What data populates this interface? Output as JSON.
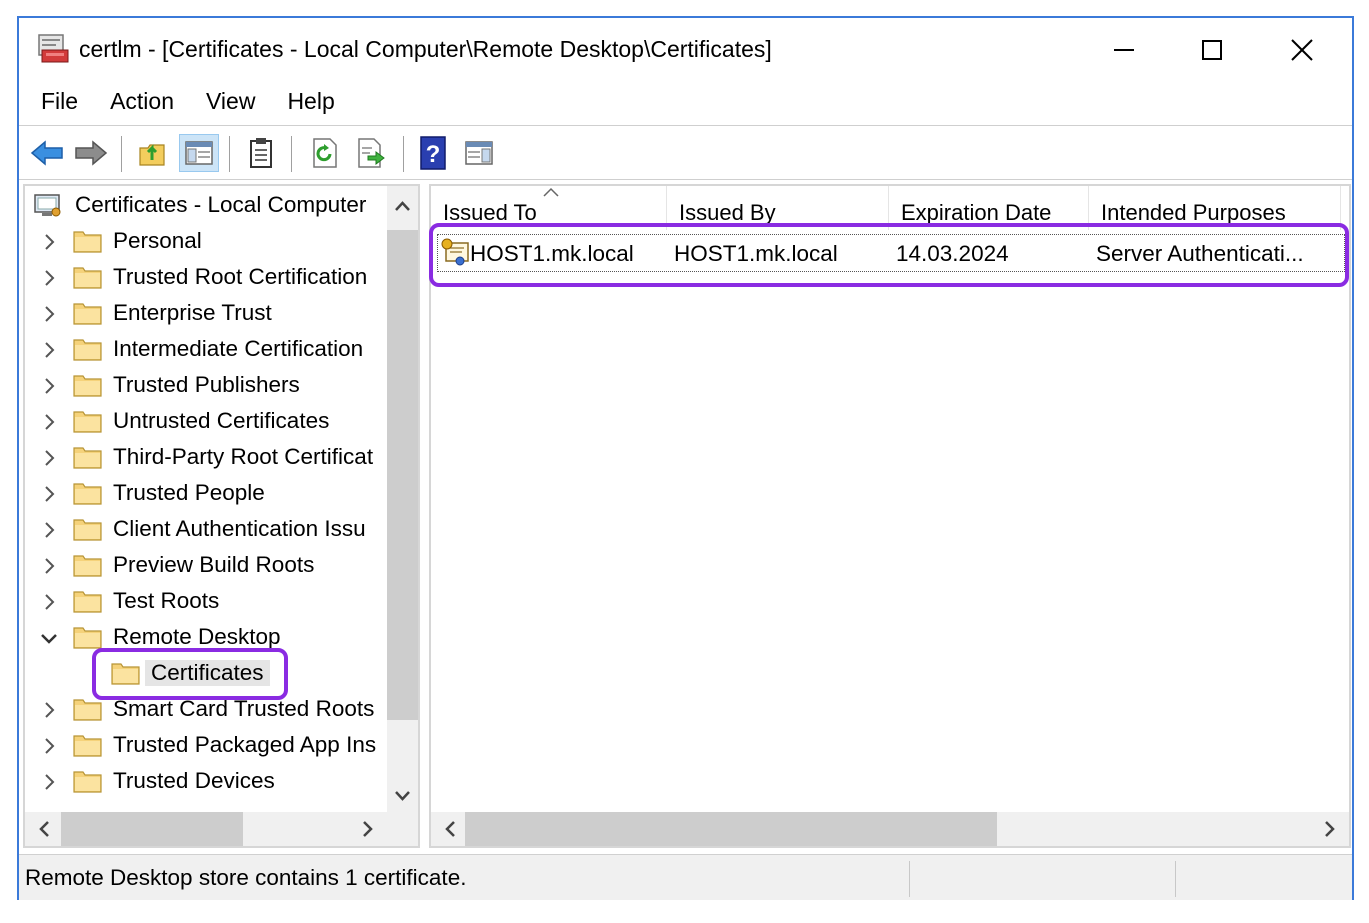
{
  "window": {
    "title": "certlm - [Certificates - Local Computer\\Remote Desktop\\Certificates]"
  },
  "menu": [
    "File",
    "Action",
    "View",
    "Help"
  ],
  "toolbar": {
    "buttons": [
      "back-icon",
      "forward-icon",
      "up-folder-icon",
      "show-hide-tree-icon",
      "clipboard-icon",
      "refresh-icon",
      "export-list-icon",
      "help-icon",
      "show-hide-action-pane-icon"
    ]
  },
  "tree": {
    "root": "Certificates - Local Computer",
    "items": [
      {
        "label": "Personal",
        "expanded": false
      },
      {
        "label": "Trusted Root Certification",
        "expanded": false
      },
      {
        "label": "Enterprise Trust",
        "expanded": false
      },
      {
        "label": "Intermediate Certification",
        "expanded": false
      },
      {
        "label": "Trusted Publishers",
        "expanded": false
      },
      {
        "label": "Untrusted Certificates",
        "expanded": false
      },
      {
        "label": "Third-Party Root Certificat",
        "expanded": false
      },
      {
        "label": "Trusted People",
        "expanded": false
      },
      {
        "label": "Client Authentication Issu",
        "expanded": false
      },
      {
        "label": "Preview Build Roots",
        "expanded": false
      },
      {
        "label": "Test Roots",
        "expanded": false
      },
      {
        "label": "Remote Desktop",
        "expanded": true
      },
      {
        "label": "Certificates",
        "child": true,
        "selected": true
      },
      {
        "label": "Smart Card Trusted Roots",
        "expanded": false
      },
      {
        "label": "Trusted Packaged App Ins",
        "expanded": false
      },
      {
        "label": "Trusted Devices",
        "expanded": false
      }
    ]
  },
  "list": {
    "columns": [
      "Issued To",
      "Issued By",
      "Expiration Date",
      "Intended Purposes"
    ],
    "rows": [
      [
        "HOST1.mk.local",
        "HOST1.mk.local",
        "14.03.2024",
        "Server Authenticati..."
      ]
    ]
  },
  "status": {
    "text": "Remote Desktop store contains 1 certificate."
  },
  "colors": {
    "window_border": "#3b7ad9",
    "highlight": "#8a2be2",
    "folder": "#f5d27a",
    "selection": "#e5e5e5"
  }
}
